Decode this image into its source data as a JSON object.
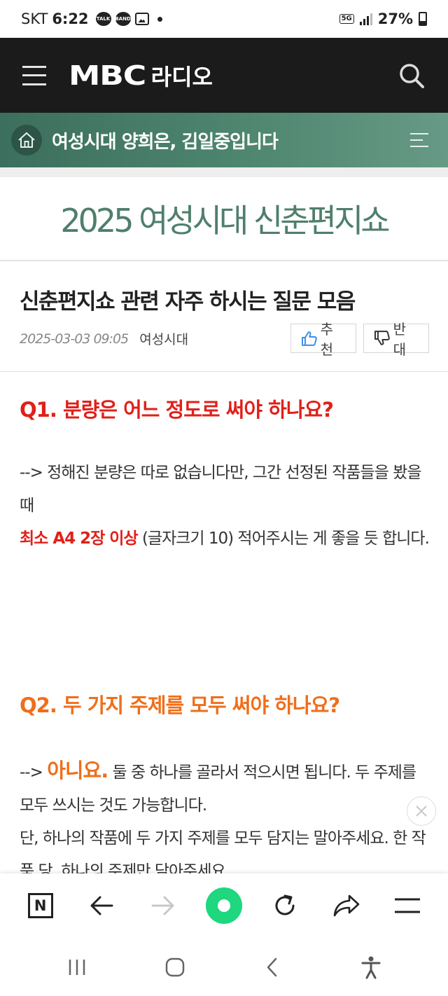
{
  "status_bar": {
    "carrier": "SKT",
    "time": "6:22",
    "notif_talk": "TALK",
    "notif_band": "BAND",
    "network": "5G",
    "battery": "27%"
  },
  "header": {
    "logo": "MBC",
    "logo_sub": "라디오"
  },
  "program": {
    "title": "여성시대 양희은, 김일중입니다"
  },
  "board": {
    "title": "2025 여성시대 신춘편지쇼"
  },
  "article": {
    "title": "신춘편지쇼 관련 자주 하시는 질문 모음",
    "date": "2025-03-03 09:05",
    "author": "여성시대",
    "like_label": "추천",
    "dislike_label": "반대"
  },
  "content": {
    "q1": "Q1. 분량은 어느 정도로 써야 하나요?",
    "a1_line1": "--> 정해진 분량은 따로 없습니다만, 그간 선정된 작품들을 봤을 때",
    "a1_highlight": "최소 A4 2장 이상",
    "a1_rest": " (글자크기 10) 적어주시는 게 좋을 듯 합니다.",
    "q2": "Q2. 두 가지 주제를 모두 써야 하나요?",
    "a2_prefix": "--> ",
    "a2_highlight": "아니요.",
    "a2_rest": " 둘 중 하나를 골라서 적으시면 됩니다. 두 주제를 모두 쓰시는 것도 가능합니다.",
    "a2_line2": "단, 하나의 작품에 두 가지 주제를 모두 담지는 말아주세요. 한 작품 당, 하나의 주제만 담아주세요."
  },
  "colors": {
    "header_bg": "#1b1b1b",
    "program_bar": "#4e8670",
    "board_title": "#4f7f6c",
    "q1": "#e0201a",
    "q2": "#f06e1a",
    "browser_home": "#1ed77e"
  },
  "toolbar_icons": [
    "naver-n-icon",
    "back-arrow-icon",
    "forward-arrow-icon",
    "home-green-icon",
    "refresh-icon",
    "share-icon",
    "menu-icon"
  ],
  "nav_icons": [
    "recent-apps-icon",
    "home-icon",
    "back-icon",
    "accessibility-icon"
  ]
}
